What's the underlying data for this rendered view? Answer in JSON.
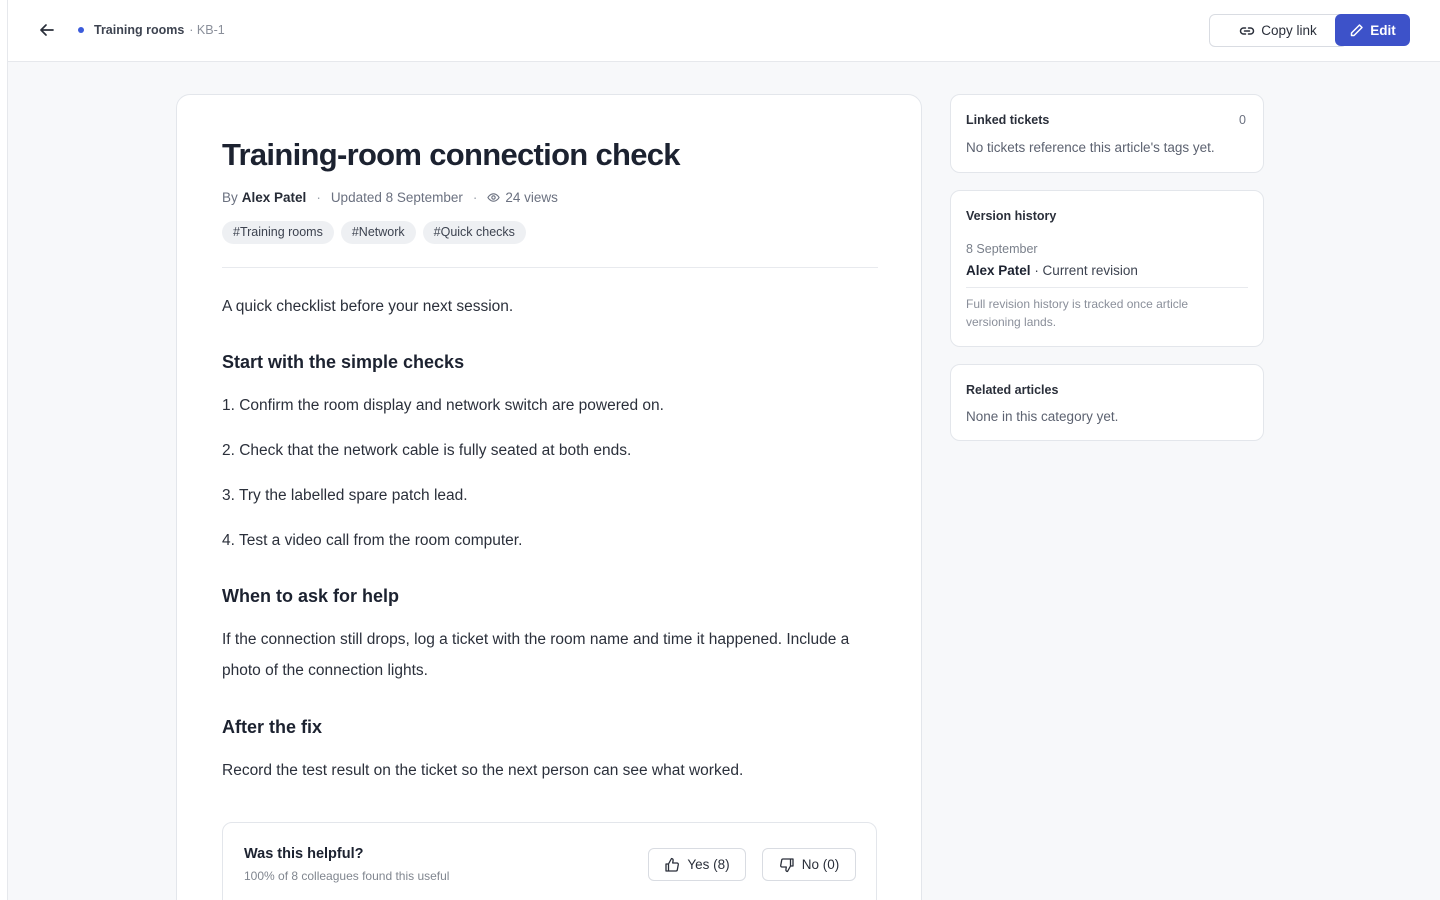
{
  "topbar": {
    "back_icon": "arrow-left-icon",
    "breadcrumb": {
      "category": "Training rooms",
      "id": "· KB-1"
    },
    "copy_link_label": "Copy link",
    "edit_label": "Edit",
    "accent_color": "#3d52c9"
  },
  "article": {
    "title": "Training-room connection check",
    "meta": {
      "by": "By",
      "author": "Alex Patel",
      "sep1": "·",
      "updated": "Updated 8 September",
      "sep2": "·",
      "views": "24 views"
    },
    "tags": [
      "#Training rooms",
      "#Network",
      "#Quick checks"
    ],
    "intro": "A quick checklist before your next session.",
    "section1": {
      "heading": "Start with the simple checks",
      "steps": [
        "1. Confirm the room display and network switch are powered on.",
        "2. Check that the network cable is fully seated at both ends.",
        "3. Try the labelled spare patch lead.",
        "4. Test a video call from the room computer."
      ]
    },
    "section2": {
      "heading": "When to ask for help",
      "text": "If the connection still drops, log a ticket with the room name and time it happened. Include a photo of the connection lights."
    },
    "section3": {
      "heading": "After the fix",
      "text": "Record the test result on the ticket so the next person can see what worked."
    },
    "feedback": {
      "question": "Was this helpful?",
      "summary": "100% of 8 colleagues found this useful",
      "yes_label": "Yes (8)",
      "no_label": "No (0)"
    }
  },
  "sidebar": {
    "linked_tickets": {
      "title": "Linked tickets",
      "count": "0",
      "empty_text": "No tickets reference this article's tags yet."
    },
    "version_history": {
      "title": "Version history",
      "date": "8 September",
      "author": "Alex Patel",
      "label": "· Current revision",
      "note": "Full revision history is tracked once article versioning lands."
    },
    "related_articles": {
      "title": "Related articles",
      "empty_text": "None in this category yet."
    }
  }
}
